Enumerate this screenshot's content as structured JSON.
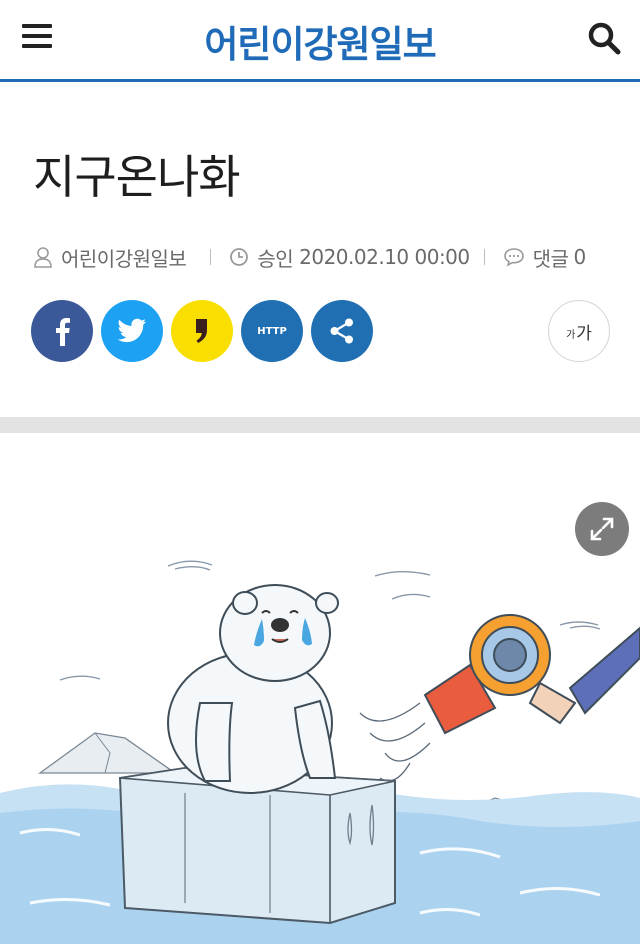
{
  "header": {
    "logo": "어린이강원일보",
    "menu_icon": "hamburger-menu-icon",
    "search_icon": "search-icon",
    "accent_color": "#1f6bb8"
  },
  "article": {
    "title": "지구온나화",
    "author": "어린이강원일보",
    "approved_label": "승인",
    "approved_datetime": "2020.02.10 00:00",
    "comment_label": "댓글",
    "comment_count": "0"
  },
  "share": {
    "http_label": "HTTP",
    "buttons": [
      "facebook-icon",
      "twitter-icon",
      "kakaostory-icon",
      "http-icon",
      "share-icon"
    ],
    "colors": {
      "facebook": "#3b5998",
      "twitter": "#1da1f2",
      "kakao": "#f9df00",
      "http": "#1f6fb2",
      "share": "#1f6fb2"
    }
  },
  "font_size": {
    "small": "가",
    "large": "가"
  },
  "image": {
    "description_icon": "polar-bear-illustration",
    "expand_icon": "expand-icon"
  }
}
